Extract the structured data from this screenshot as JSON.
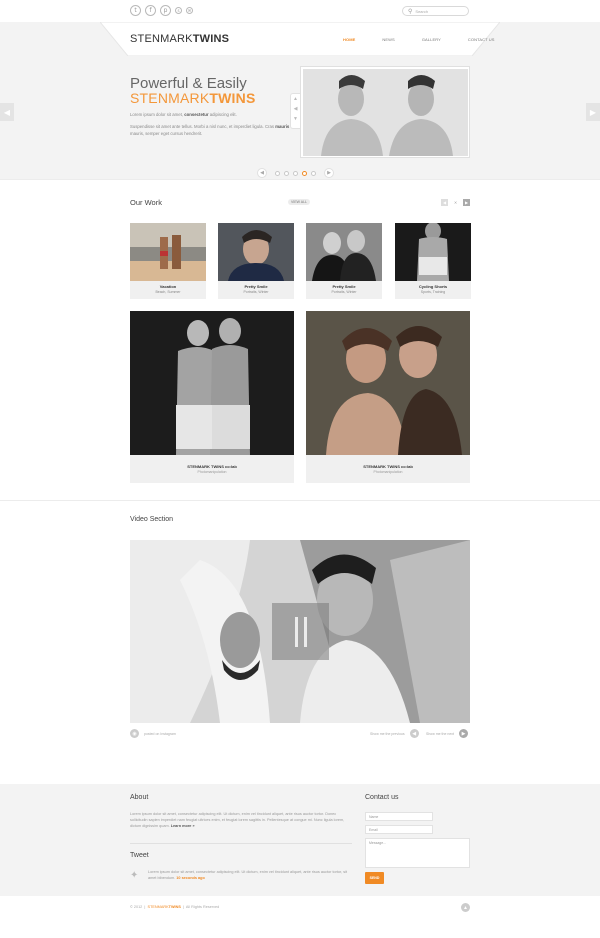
{
  "header": {
    "social": [
      {
        "icon": "twitter-icon",
        "glyph": "t"
      },
      {
        "icon": "facebook-icon",
        "glyph": "f"
      },
      {
        "icon": "pinterest-icon",
        "glyph": "p"
      },
      {
        "icon": "skype-icon",
        "glyph": "s"
      },
      {
        "icon": "email-icon",
        "glyph": "✉"
      }
    ],
    "search_placeholder": "Search",
    "logo_light": "STENMARK",
    "logo_bold": "TWINS",
    "nav": [
      {
        "label": "Home",
        "active": true
      },
      {
        "label": "News",
        "active": false
      },
      {
        "label": "Gallery",
        "active": false
      },
      {
        "label": "Contact Us",
        "active": false
      }
    ]
  },
  "hero": {
    "title1": "Powerful & Easily",
    "title2_light": "STENMARK",
    "title2_bold": "TWINS",
    "p1_before": "Lorem ipsum dolor sit amet, ",
    "p1_bold": "consectetur",
    "p1_after": " adipiscing elit.",
    "p2_before": "Suspendisse sit amet ante tellus. Morbi a nisl nunc, et imperdiet ligula. Cras ",
    "p2_bold": "mauris",
    "p2_after": " mauris, semper eget cursus hendrerit.",
    "active_slide": 4,
    "slide_count": 5
  },
  "work": {
    "title": "Our Work",
    "view_all": "View All",
    "cards": [
      {
        "title": "Vacation",
        "sub": "Beach, Summer"
      },
      {
        "title": "Pretty Smile",
        "sub": "Portraits, Winter"
      },
      {
        "title": "Pretty Smile",
        "sub": "Portraits, Winter"
      },
      {
        "title": "Cycling Shorts",
        "sub": "Sports, Training"
      }
    ],
    "big": [
      {
        "title": "STENMARK TWINS co:lab",
        "sub": "Photomanipulation"
      },
      {
        "title": "STENMARK TWINS co:lab",
        "sub": "Photomanipulation"
      }
    ]
  },
  "video": {
    "title": "Video Section",
    "left_caption": "posted on Instagram",
    "prev_caption": "Show me the previous",
    "next_caption": "Show me the next"
  },
  "footer": {
    "about_title": "About",
    "about_text": "Lorem ipsum dolor sit amet, consectetur adipiscing elit. Ut dictum, enim vel tincidunt aliquet, ante risus auctor tortor. Donec sollicitudin sapien imperdiet nam feugiat ultrices enim, et feugiat lorem sagittis in. Pellentesque at congue mi. Nunc ligula lorem, dictum dignissim quam. ",
    "about_more": "Learn more »",
    "tweet_title": "Tweet",
    "tweet_text": "Lorem ipsum dolor sit amet, consectetur adipiscing elit. Ut dictum, enim vel tincidunt aliquet, ante risus auctor tortor, sit amet bibendum.",
    "tweet_ago": "10 seconds ago",
    "contact_title": "Contact us",
    "name_placeholder": "Name",
    "email_placeholder": "Email",
    "message_placeholder": "Message...",
    "send": "Send",
    "copy_year": "© 2012",
    "copy_brand_light": "STENMARK",
    "copy_brand_bold": "TWINS",
    "copy_rights": "All Rights Reserved"
  }
}
